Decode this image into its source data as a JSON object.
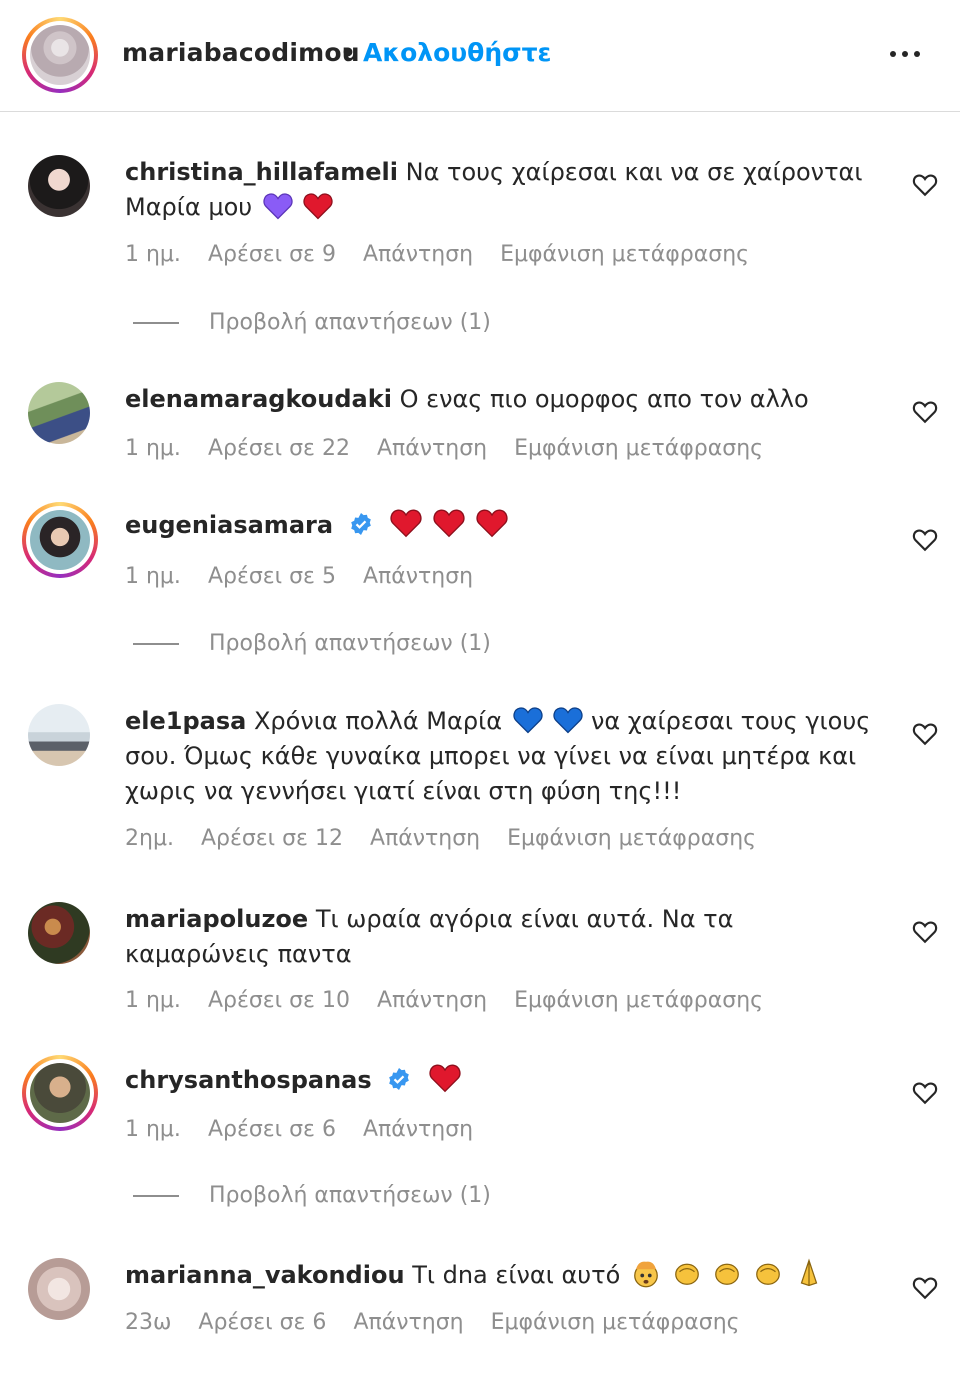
{
  "header": {
    "username": "mariabacodimou",
    "separator": "•",
    "follow": "Ακολουθήστε"
  },
  "comments": [
    {
      "username": "christina_hillafameli",
      "text": "Να τους χαίρεσαι και να σε χαίρονται Μαρία μου",
      "time": "1 ημ.",
      "likes": "Αρέσει σε 9",
      "reply": "Απάντηση",
      "translate": "Εμφάνιση μετάφρασης",
      "view_replies": "Προβολή απαντήσεων (1)",
      "emojis": [
        "purple-heart",
        "red-heart"
      ]
    },
    {
      "username": "elenamaragkoudaki",
      "text": "Ο ενας πιο ομορφος απο τον αλλο",
      "time": "1 ημ.",
      "likes": "Αρέσει σε 22",
      "reply": "Απάντηση",
      "translate": "Εμφάνιση μετάφρασης"
    },
    {
      "username": "eugeniasamara",
      "text": "",
      "time": "1 ημ.",
      "likes": "Αρέσει σε 5",
      "reply": "Απάντηση",
      "view_replies": "Προβολή απαντήσεων (1)",
      "emojis": [
        "red-heart",
        "red-heart",
        "red-heart"
      ]
    },
    {
      "username": "ele1pasa",
      "text_a": "Χρόνια πολλά Μαρία",
      "text_b": "να χαίρεσαι τους γιους σου. Όμως κάθε γυναίκα μπορει να γίνει να είναι μητέρα και χωρις να γεννήσει γιατί είναι στη φύση της!!!",
      "time": "2ημ.",
      "likes": "Αρέσει σε 12",
      "reply": "Απάντηση",
      "translate": "Εμφάνιση μετάφρασης",
      "emojis": [
        "blue-heart",
        "blue-heart"
      ]
    },
    {
      "username": "mariapoluzoe",
      "text": "Τι ωραία αγόρια είναι αυτά. Να τα καμαρώνεις παντα",
      "time": "1 ημ.",
      "likes": "Αρέσει σε 10",
      "reply": "Απάντηση",
      "translate": "Εμφάνιση μετάφρασης"
    },
    {
      "username": "chrysanthospanas",
      "text": "",
      "time": "1 ημ.",
      "likes": "Αρέσει σε 6",
      "reply": "Απάντηση",
      "view_replies": "Προβολή απαντήσεων (1)",
      "emojis": [
        "red-heart"
      ]
    },
    {
      "username": "marianna_vakondiou",
      "text": "Τι dna είναι αυτό",
      "time": "23ω",
      "likes": "Αρέσει σε 6",
      "reply": "Απάντηση",
      "translate": "Εμφάνιση μετάφρασης",
      "emojis": [
        "exploding-head",
        "clapping-hands",
        "clapping-hands",
        "clapping-hands",
        "folded-hands"
      ]
    }
  ],
  "colors": {
    "text": "#262626",
    "secondary": "#8e8e8e",
    "link": "#0095f6",
    "verified": "#3897f0",
    "red_heart": "#e0182d",
    "blue_heart": "#1a6fd9",
    "purple_heart": "#8a5cf6"
  }
}
